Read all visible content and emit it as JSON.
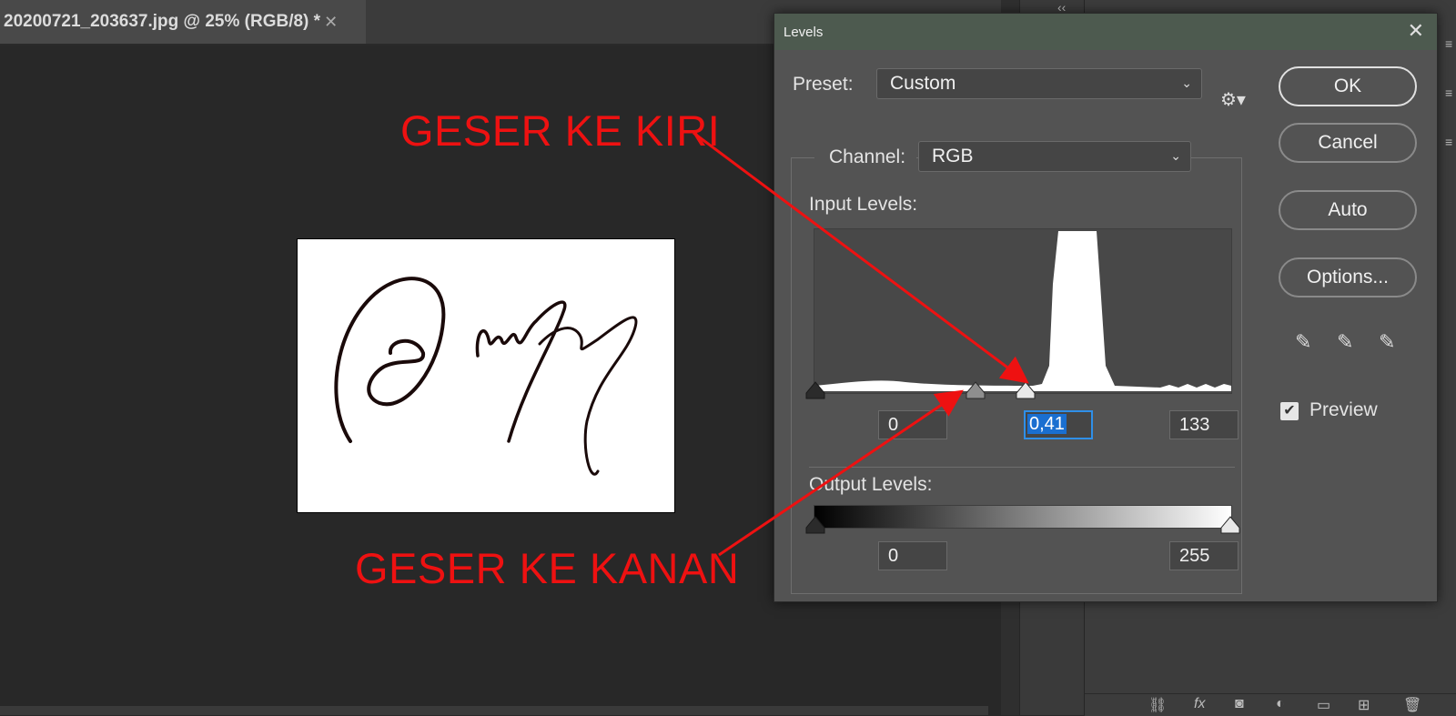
{
  "document": {
    "tab_title": "20200721_203637.jpg @ 25% (RGB/8) *",
    "close_glyph": "✕"
  },
  "annotations": {
    "left_text": "GESER KE KIRI",
    "right_text": "GESER KE KANAN",
    "color": "#ee1111"
  },
  "dialog": {
    "title": "Levels",
    "close_glyph": "✕",
    "preset_label": "Preset:",
    "preset_value": "Custom",
    "channel_label": "Channel:",
    "channel_value": "RGB",
    "input_levels_label": "Input Levels:",
    "output_levels_label": "Output Levels:",
    "input_black": "0",
    "input_gamma": "0,41",
    "input_white": "133",
    "output_black": "0",
    "output_white": "255",
    "buttons": {
      "ok": "OK",
      "cancel": "Cancel",
      "auto": "Auto",
      "options": "Options..."
    },
    "preview_label": "Preview",
    "preview_checked": true,
    "icons": [
      "settings-gear-icon",
      "black-point-eyedropper-icon",
      "gray-point-eyedropper-icon",
      "white-point-eyedropper-icon"
    ]
  },
  "panels": {
    "collapse_glyph": "‹‹"
  }
}
